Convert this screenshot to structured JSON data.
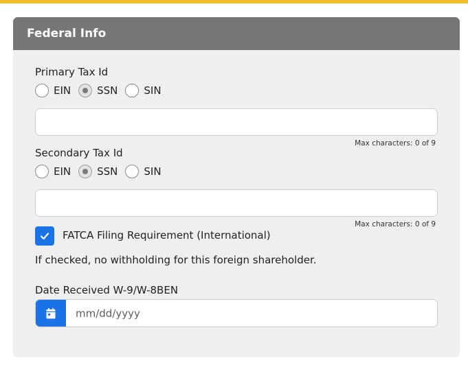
{
  "card": {
    "title": "Federal Info"
  },
  "primary_tax": {
    "label": "Primary Tax Id",
    "options": [
      "EIN",
      "SSN",
      "SIN"
    ],
    "selected": "SSN",
    "value": "",
    "counter": "Max characters: 0 of 9"
  },
  "secondary_tax": {
    "label": "Secondary Tax Id",
    "options": [
      "EIN",
      "SSN",
      "SIN"
    ],
    "selected": "SSN",
    "value": "",
    "counter": "Max characters: 0 of 9"
  },
  "fatca": {
    "checked": true,
    "label": "FATCA Filing Requirement (International)",
    "note": "If checked, no withholding for this foreign shareholder."
  },
  "date_received": {
    "label": "Date Received W-9/W-8BEN",
    "placeholder": "mm/dd/yyyy",
    "value": ""
  },
  "colors": {
    "accent": "#1a73e8",
    "header": "#767676",
    "top_bar": "#f2bd26"
  }
}
